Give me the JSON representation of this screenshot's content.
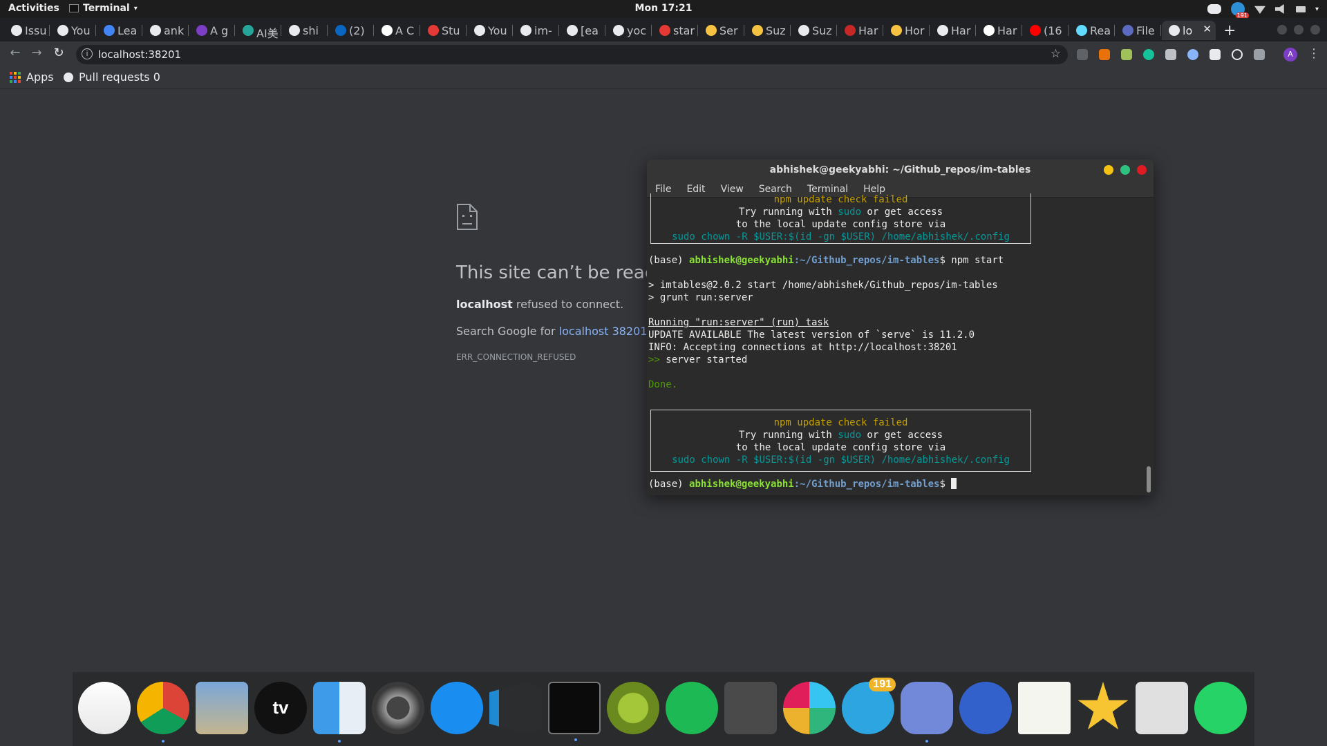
{
  "topbar": {
    "activities": "Activities",
    "app_name": "Terminal",
    "clock": "Mon 17:21",
    "tray_badge": "191"
  },
  "tabs": [
    {
      "label": "Issu",
      "icon": "github-icon",
      "color": "#e8eaed"
    },
    {
      "label": "You",
      "icon": "github-icon",
      "color": "#e8eaed"
    },
    {
      "label": "Lea",
      "icon": "leaf-icon",
      "color": "#4285f4"
    },
    {
      "label": "ank",
      "icon": "github-icon",
      "color": "#e8eaed"
    },
    {
      "label": "A g",
      "icon": "a-icon",
      "color": "#7b3ec4"
    },
    {
      "label": "AI美",
      "icon": "circle-icon",
      "color": "#26a69a"
    },
    {
      "label": "shi",
      "icon": "google-icon",
      "color": "#e8eaed"
    },
    {
      "label": "(2)",
      "icon": "linkedin-icon",
      "color": "#0a66c2"
    },
    {
      "label": "A C",
      "icon": "medium-icon",
      "color": "#ffffff"
    },
    {
      "label": "Stu",
      "icon": "color-icon",
      "color": "#e53935"
    },
    {
      "label": "You",
      "icon": "github-icon",
      "color": "#e8eaed"
    },
    {
      "label": "im-",
      "icon": "github-icon",
      "color": "#e8eaed"
    },
    {
      "label": "[ea",
      "icon": "github-icon",
      "color": "#e8eaed"
    },
    {
      "label": "yoc",
      "icon": "github-icon",
      "color": "#e8eaed"
    },
    {
      "label": "star",
      "icon": "square-icon",
      "color": "#e53935"
    },
    {
      "label": "Ser",
      "icon": "face-icon",
      "color": "#f5c242"
    },
    {
      "label": "Suz",
      "icon": "face-icon",
      "color": "#f5c242"
    },
    {
      "label": "Suz",
      "icon": "github-icon",
      "color": "#e8eaed"
    },
    {
      "label": "Har",
      "icon": "hacker-icon",
      "color": "#c62828"
    },
    {
      "label": "Hor",
      "icon": "sun-icon",
      "color": "#f5c242"
    },
    {
      "label": "Har",
      "icon": "globe-icon",
      "color": "#e8eaed"
    },
    {
      "label": "Har",
      "icon": "medium-icon",
      "color": "#ffffff"
    },
    {
      "label": "(16",
      "icon": "youtube-icon",
      "color": "#ff0000"
    },
    {
      "label": "Rea",
      "icon": "react-icon",
      "color": "#61dafb"
    },
    {
      "label": "File",
      "icon": "grid-icon",
      "color": "#5c6bc0"
    },
    {
      "label": "lo",
      "icon": "globe-icon",
      "color": "#e8eaed",
      "active": true
    }
  ],
  "toolbar": {
    "url": "localhost:38201",
    "info_glyph": "i",
    "avatar_letter": "A"
  },
  "bookmarks": [
    {
      "label": "Apps",
      "icon": "apps-grid-icon"
    },
    {
      "label": "Pull requests 0",
      "icon": "github-icon"
    }
  ],
  "error_page": {
    "title": "This site can’t be reached",
    "host": "localhost",
    "refused_text": " refused to connect.",
    "search_prefix": "Search Google for ",
    "search_link": "localhost 38201",
    "code": "ERR_CONNECTION_REFUSED"
  },
  "terminal": {
    "title": "abhishek@geekyabhi: ~/Github_repos/im-tables",
    "menu": [
      "File",
      "Edit",
      "View",
      "Search",
      "Terminal",
      "Help"
    ],
    "box": {
      "heading": "npm update check failed",
      "line2_a": "Try running with ",
      "line2_b": "sudo",
      "line2_c": " or get access",
      "line3": "to the local update config store via",
      "line4": "sudo chown -R $USER:$(id -gn $USER) /home/abhishek/.config"
    },
    "prompt_prefix": "(base) ",
    "prompt_user": "abhishek@geekyabhi",
    "prompt_path": ":~/Github_repos/im-tables",
    "prompt_dollar": "$",
    "command": " npm start",
    "out1": "> imtables@2.0.2 start /home/abhishek/Github_repos/im-tables",
    "out2": "> grunt run:server",
    "running": "Running \"run:server\" (run) task",
    "update": "UPDATE AVAILABLE The latest version of `serve` is 11.2.0",
    "info": "INFO: Accepting connections at http://localhost:38201",
    "arrows": ">>",
    "started": " server started",
    "done": "Done."
  },
  "dock": {
    "apps": [
      {
        "name": "music-icon"
      },
      {
        "name": "chrome-icon"
      },
      {
        "name": "preview-icon"
      },
      {
        "name": "appletv-icon"
      },
      {
        "name": "finder-icon"
      },
      {
        "name": "settings-icon"
      },
      {
        "name": "appstore-icon"
      },
      {
        "name": "vscode-icon"
      },
      {
        "name": "terminal-icon"
      },
      {
        "name": "android-studio-icon"
      },
      {
        "name": "spotify-icon"
      },
      {
        "name": "sublime-icon"
      },
      {
        "name": "slack-icon"
      },
      {
        "name": "telegram-icon"
      },
      {
        "name": "discord-icon"
      },
      {
        "name": "simplenote-icon"
      },
      {
        "name": "textedit-icon"
      },
      {
        "name": "starred-icon"
      },
      {
        "name": "screenshot-icon"
      },
      {
        "name": "whatsapp-icon"
      }
    ],
    "telegram_badge": "191",
    "appletv_label": "tv"
  }
}
